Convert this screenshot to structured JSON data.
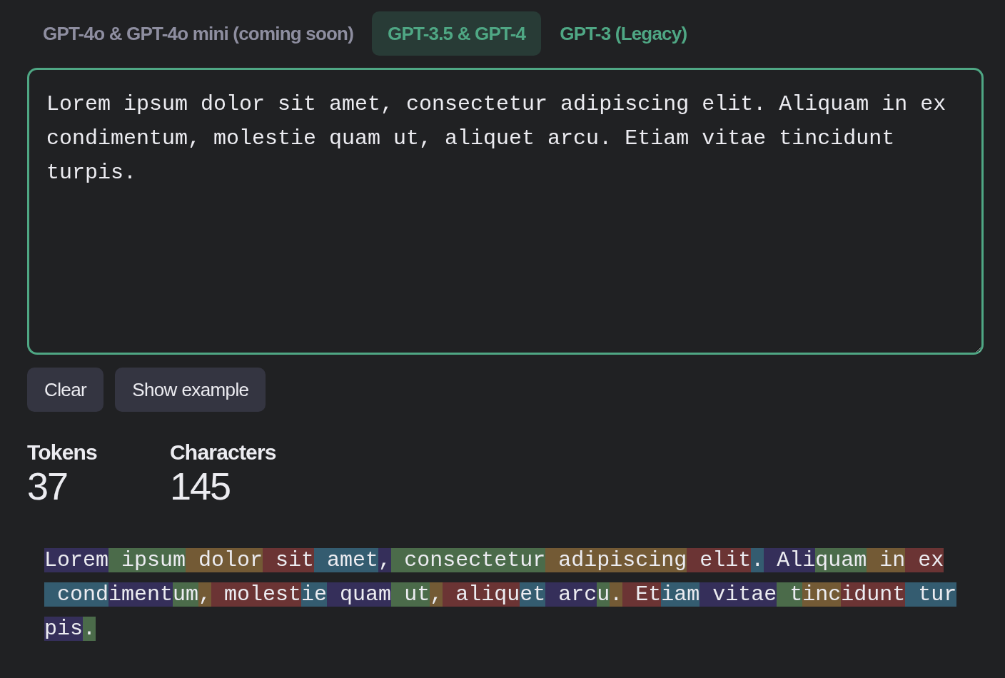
{
  "tabs": [
    {
      "label": "GPT-4o & GPT-4o mini (coming soon)",
      "selected": false,
      "disabled": true
    },
    {
      "label": "GPT-3.5 & GPT-4",
      "selected": true,
      "disabled": false
    },
    {
      "label": "GPT-3 (Legacy)",
      "selected": false,
      "disabled": false
    }
  ],
  "input": {
    "value": "Lorem ipsum dolor sit amet, consectetur adipiscing elit. Aliquam in ex condimentum, molestie quam ut, aliquet arcu. Etiam vitae tincidunt turpis."
  },
  "buttons": [
    "Clear",
    "Show example"
  ],
  "stats": [
    {
      "label": "Tokens",
      "value": "37"
    },
    {
      "label": "Characters",
      "value": "145"
    }
  ],
  "tokens": [
    {
      "text": "Lorem",
      "color": "#352f5a"
    },
    {
      "text": " ipsum",
      "color": "#4b6b4a"
    },
    {
      "text": " dolor",
      "color": "#735a35"
    },
    {
      "text": " sit",
      "color": "#6b3434"
    },
    {
      "text": " amet",
      "color": "#345c70"
    },
    {
      "text": ",",
      "color": "#352f5a"
    },
    {
      "text": " consectetur",
      "color": "#4b6b4a"
    },
    {
      "text": " adipiscing",
      "color": "#735a35"
    },
    {
      "text": " elit",
      "color": "#6b3434"
    },
    {
      "text": ".",
      "color": "#345c70"
    },
    {
      "text": " Ali",
      "color": "#352f5a"
    },
    {
      "text": "quam",
      "color": "#4b6b4a"
    },
    {
      "text": " in",
      "color": "#735a35"
    },
    {
      "text": " ex",
      "color": "#6b3434"
    },
    {
      "text": " cond",
      "color": "#345c70"
    },
    {
      "text": "iment",
      "color": "#352f5a"
    },
    {
      "text": "um",
      "color": "#4b6b4a"
    },
    {
      "text": ",",
      "color": "#735a35"
    },
    {
      "text": " molest",
      "color": "#6b3434"
    },
    {
      "text": "ie",
      "color": "#345c70"
    },
    {
      "text": " quam",
      "color": "#352f5a"
    },
    {
      "text": " ut",
      "color": "#4b6b4a"
    },
    {
      "text": ",",
      "color": "#735a35"
    },
    {
      "text": " aliqu",
      "color": "#6b3434"
    },
    {
      "text": "et",
      "color": "#345c70"
    },
    {
      "text": " arc",
      "color": "#352f5a"
    },
    {
      "text": "u",
      "color": "#4b6b4a"
    },
    {
      "text": ".",
      "color": "#735a35"
    },
    {
      "text": " Et",
      "color": "#6b3434"
    },
    {
      "text": "iam",
      "color": "#345c70"
    },
    {
      "text": " vitae",
      "color": "#352f5a"
    },
    {
      "text": " t",
      "color": "#4b6b4a"
    },
    {
      "text": "inc",
      "color": "#735a35"
    },
    {
      "text": "idunt",
      "color": "#6b3434"
    },
    {
      "text": " tur",
      "color": "#345c70"
    },
    {
      "text": "pis",
      "color": "#352f5a"
    },
    {
      "text": ".",
      "color": "#4b6b4a"
    }
  ]
}
